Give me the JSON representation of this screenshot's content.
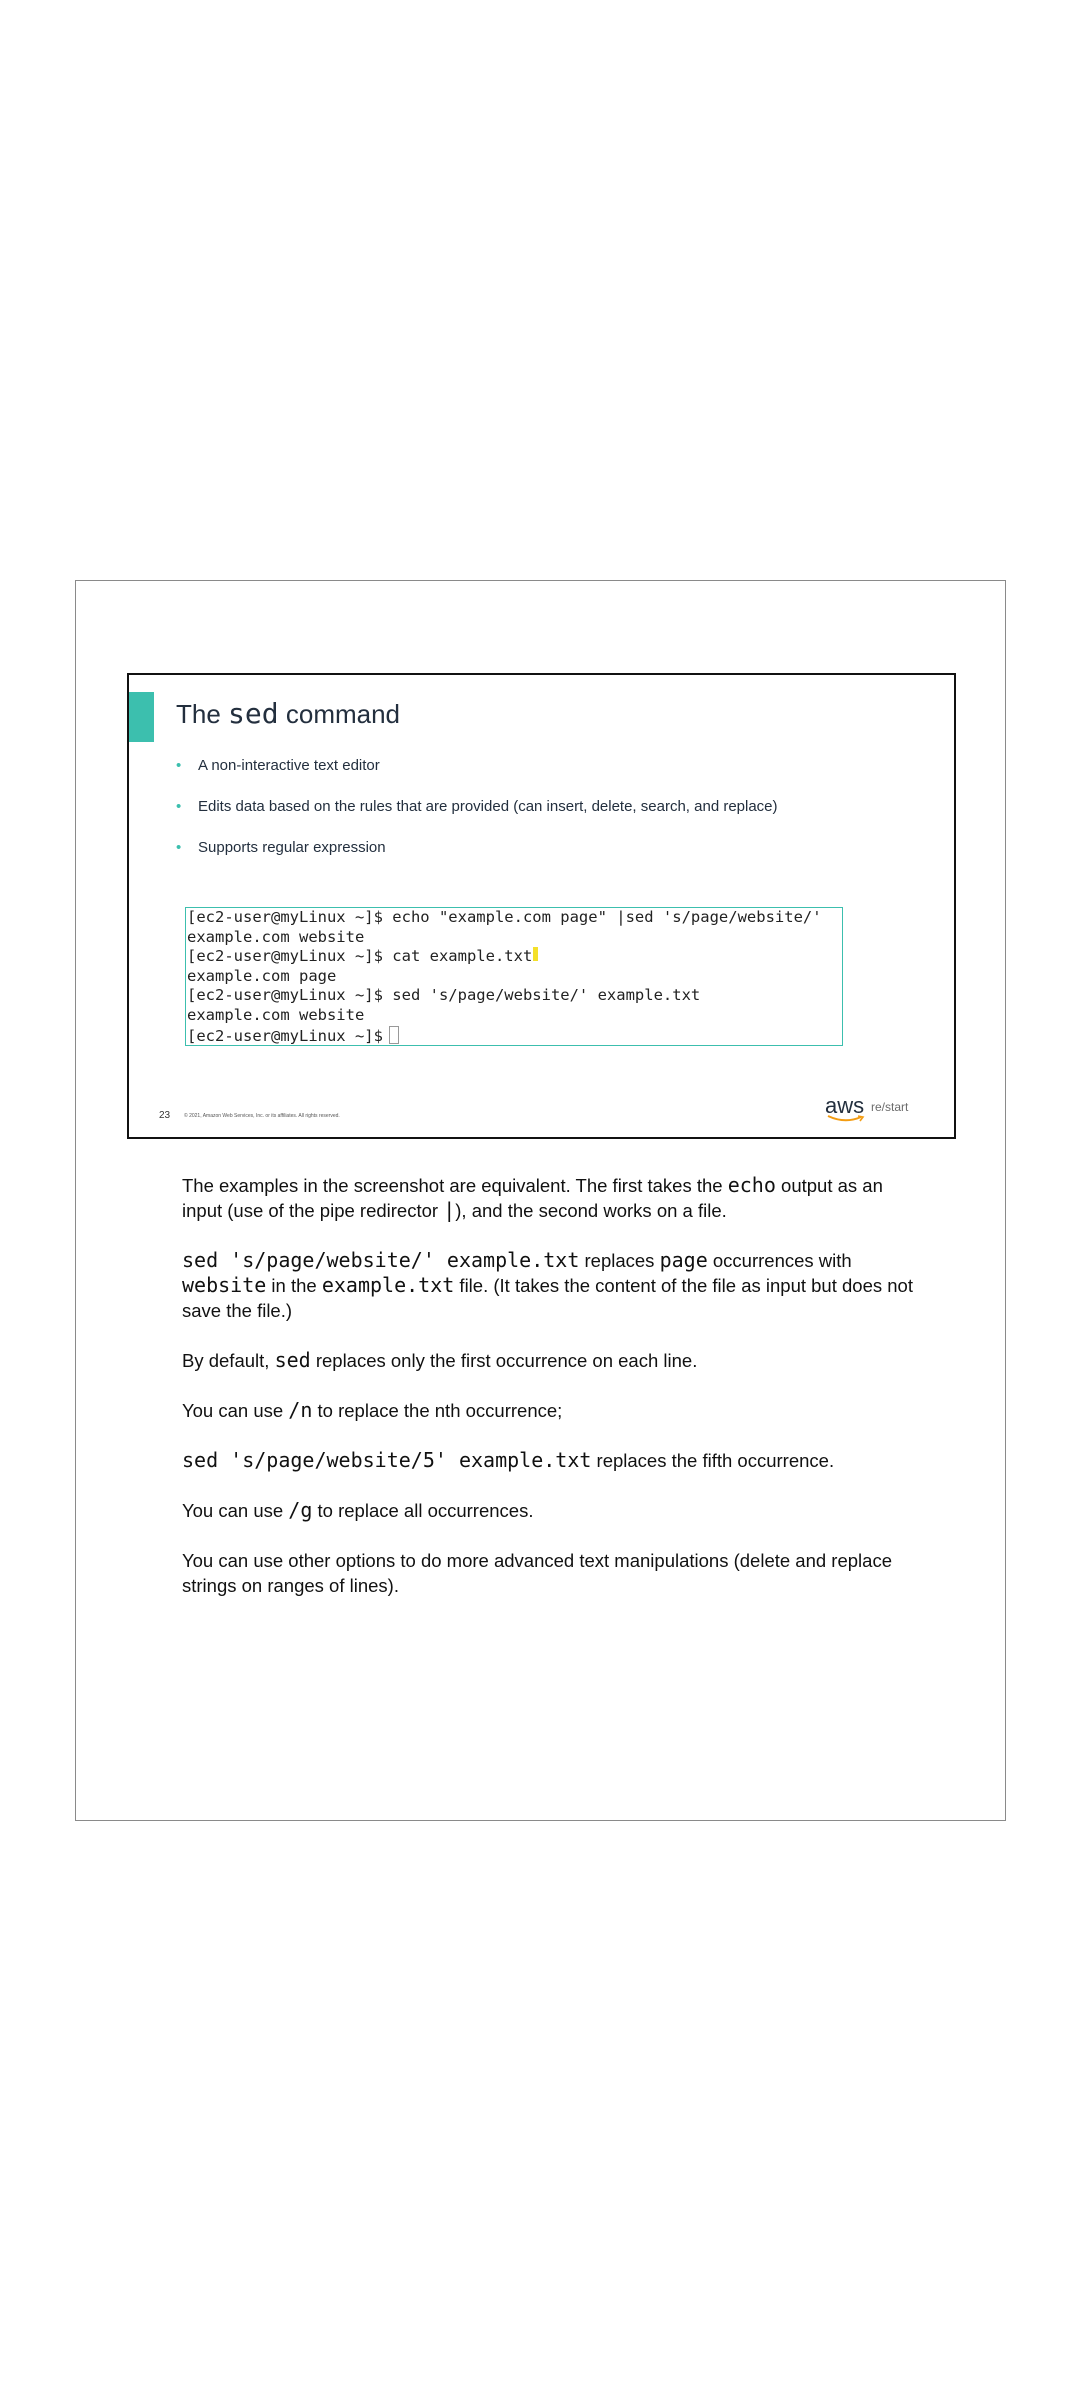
{
  "slide": {
    "title_prefix": "The",
    "title_code": "sed",
    "title_suffix": "command",
    "bullets": [
      "A non-interactive text editor",
      "Edits data based on the rules that are provided (can insert, delete, search, and replace)",
      "Supports regular expression"
    ],
    "terminal_lines": [
      "[ec2-user@myLinux ~]$ echo \"example.com page\" |sed 's/page/website/'",
      "example.com website",
      "[ec2-user@myLinux ~]$ cat example.txt",
      "example.com page",
      "[ec2-user@myLinux ~]$ sed 's/page/website/' example.txt",
      "example.com website",
      "[ec2-user@myLinux ~]$"
    ],
    "slide_number": "23",
    "copyright": "© 2021, Amazon Web Services, Inc. or its affiliates. All rights reserved.",
    "logo_aws": "aws",
    "logo_restart": "re/start",
    "accent_color": "#3cbfae"
  },
  "notes": {
    "p1_a": "The examples in the screenshot are equivalent. The first takes the ",
    "p1_code1": "echo",
    "p1_b": " output as an input (use of the pipe redirector ",
    "p1_code2": "|",
    "p1_c": "), and the second works on a file.",
    "p2_code1": "sed 's/page/website/' example.txt",
    "p2_a": " replaces ",
    "p2_code2": "page",
    "p2_b": " occurrences with ",
    "p2_code3": "website",
    "p2_c": " in the ",
    "p2_code4": "example.txt",
    "p2_d": " file. (It takes the content of the file as input but does not save the file.)",
    "p3_a": "By default, ",
    "p3_code": "sed",
    "p3_b": " replaces only the first occurrence on each line.",
    "p4_a": "You can use ",
    "p4_code": "/n",
    "p4_b": " to replace the nth occurrence;",
    "p5_code": "sed 's/page/website/5' example.txt",
    "p5_a": " replaces the fifth occurrence.",
    "p6_a": "You can use ",
    "p6_code": "/g",
    "p6_b": " to replace all occurrences.",
    "p7": "You can use other options to do more advanced text manipulations (delete and replace strings on ranges of lines)."
  }
}
